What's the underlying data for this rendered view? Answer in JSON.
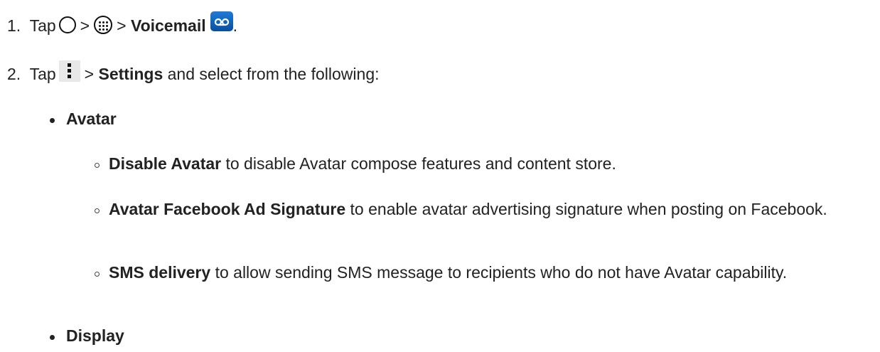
{
  "steps": [
    {
      "number": "1.",
      "tap": "Tap",
      "sep1": ">",
      "sep2": ">",
      "target": "Voicemail",
      "end": "."
    },
    {
      "number": "2.",
      "tap": "Tap",
      "sep": ">",
      "target": "Settings",
      "rest": "and select from the following:"
    }
  ],
  "sections": [
    {
      "title": "Avatar",
      "items": [
        {
          "bold": "Disable Avatar",
          "text": "to disable Avatar compose features and content store."
        },
        {
          "bold": "Avatar Facebook Ad Signature",
          "text": "to enable avatar advertising signature when posting on Facebook."
        },
        {
          "bold": "SMS delivery",
          "text": "to allow sending SMS message to recipients who do not have Avatar capability."
        }
      ]
    },
    {
      "title": "Display"
    }
  ],
  "icons": {
    "home": "home-circle-icon",
    "apps": "apps-grid-icon",
    "voicemail": "voicemail-icon",
    "menu": "overflow-menu-icon",
    "voicemail_color": "#1565c0"
  }
}
